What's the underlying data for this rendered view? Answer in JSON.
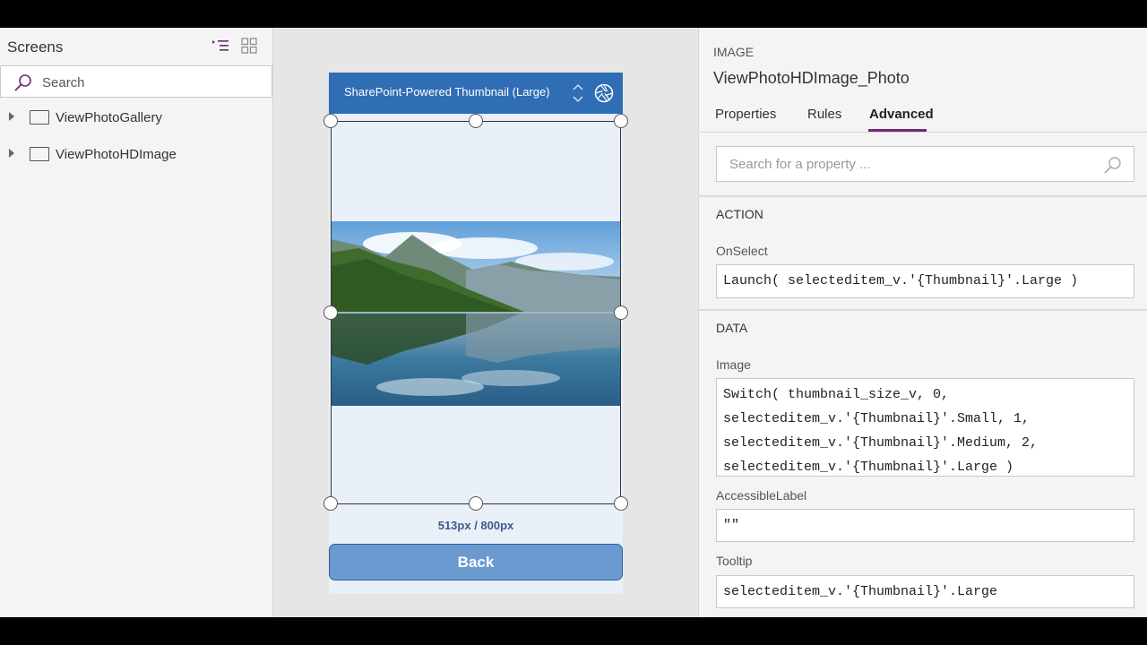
{
  "screens_panel": {
    "title": "Screens",
    "search_placeholder": "Search",
    "items": [
      {
        "label": "ViewPhotoGallery"
      },
      {
        "label": "ViewPhotoHDImage"
      }
    ]
  },
  "canvas": {
    "header_title": "SharePoint-Powered Thumbnail (Large)",
    "size_label": "513px / 800px",
    "back_label": "Back"
  },
  "properties_panel": {
    "control_type": "IMAGE",
    "control_name": "ViewPhotoHDImage_Photo",
    "tabs": [
      {
        "label": "Properties"
      },
      {
        "label": "Rules"
      },
      {
        "label": "Advanced"
      }
    ],
    "active_tab": "Advanced",
    "search_placeholder": "Search for a property ...",
    "sections": {
      "action": {
        "title": "ACTION",
        "onselect_label": "OnSelect",
        "onselect_value": "Launch( selecteditem_v.'{Thumbnail}'.Large )"
      },
      "data": {
        "title": "DATA",
        "image_label": "Image",
        "image_value": "Switch( thumbnail_size_v, 0,\nselecteditem_v.'{Thumbnail}'.Small, 1,\nselecteditem_v.'{Thumbnail}'.Medium, 2,\nselecteditem_v.'{Thumbnail}'.Large )",
        "accessible_label": "AccessibleLabel",
        "accessible_value": "\"\"",
        "tooltip_label": "Tooltip",
        "tooltip_value": "selecteditem_v.'{Thumbnail}'.Large"
      }
    }
  },
  "colors": {
    "accent": "#742774",
    "header_blue": "#2f6db4",
    "button_blue": "#6b9ad0"
  }
}
